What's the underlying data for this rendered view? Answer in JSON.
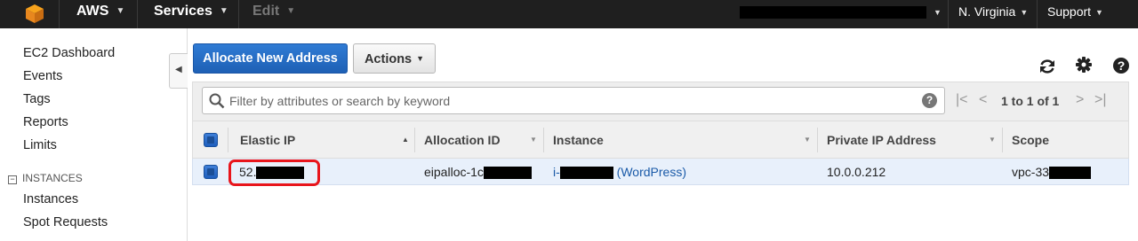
{
  "nav": {
    "brand": "AWS",
    "services": "Services",
    "edit": "Edit",
    "region": "N. Virginia",
    "support": "Support"
  },
  "sidebar": {
    "items": [
      {
        "label": "EC2 Dashboard"
      },
      {
        "label": "Events"
      },
      {
        "label": "Tags"
      },
      {
        "label": "Reports"
      },
      {
        "label": "Limits"
      }
    ],
    "section": "INSTANCES",
    "section_items": [
      {
        "label": "Instances"
      },
      {
        "label": "Spot Requests"
      }
    ]
  },
  "toolbar": {
    "allocate_label": "Allocate New Address",
    "actions_label": "Actions"
  },
  "filter": {
    "placeholder": "Filter by attributes or search by keyword",
    "help": "?",
    "page_info": "1 to 1 of 1"
  },
  "table": {
    "columns": [
      "Elastic IP",
      "Allocation ID",
      "Instance",
      "Private IP Address",
      "Scope"
    ],
    "row": {
      "elastic_ip": "52.",
      "allocation_id": "eipalloc-1c",
      "instance_prefix": "i-",
      "instance_name": "(WordPress)",
      "private_ip": "10.0.0.212",
      "scope": "vpc-33"
    }
  },
  "colors": {
    "nav_bg": "#1f1f1f",
    "primary": "#1e60b5",
    "link": "#1a5aa8",
    "highlight": "#e8151c",
    "row_selected": "#e8f0fb"
  }
}
